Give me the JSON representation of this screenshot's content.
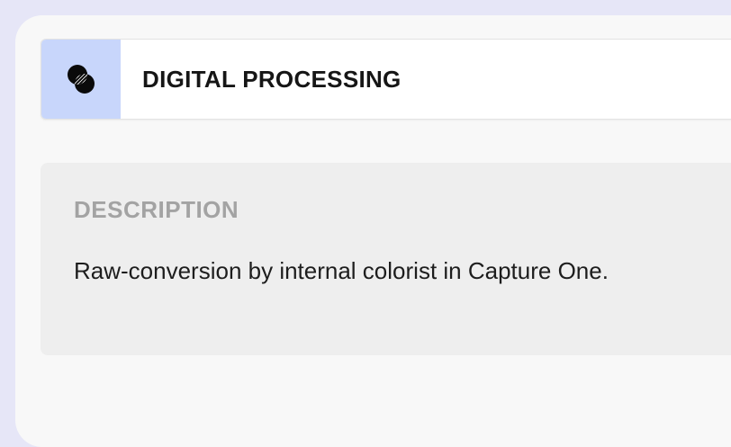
{
  "section": {
    "title": "DIGITAL PROCESSING",
    "icon": "processing-circles-icon"
  },
  "description": {
    "label": "DESCRIPTION",
    "text": "Raw-conversion by internal colorist in Capture One."
  },
  "colors": {
    "page_background": "#e6e6f7",
    "card_background": "#f8f8f8",
    "icon_background": "#c8d6fb",
    "description_panel": "#eeeeee",
    "label_text": "#a3a3a3",
    "body_text": "#1d1d1d"
  }
}
